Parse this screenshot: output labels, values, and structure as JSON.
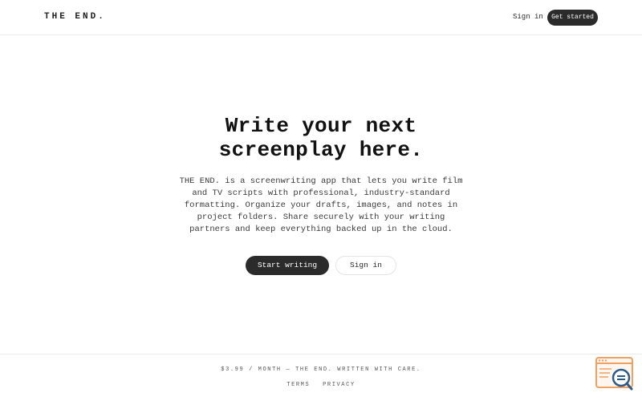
{
  "header": {
    "logo": "THE END.",
    "sign_in": "Sign in",
    "get_started": "Get started"
  },
  "hero": {
    "title_line1": "Write your next",
    "title_line2": "screenplay here.",
    "description": [
      "THE END. is a screenwriting app that lets you write film",
      "and TV scripts with professional, industry-standard",
      "formatting. Organize your drafts, images, and notes in",
      "project folders. Share securely with your writing",
      "partners and keep everything backed up in the cloud."
    ],
    "primary_button": "Start writing",
    "secondary_button": "Sign in"
  },
  "footer": {
    "note": "$3.99 / MONTH — THE END. WRITTEN WITH CARE.",
    "links": [
      "TERMS",
      "PRIVACY"
    ]
  },
  "widget": {
    "icon": "browser-search-icon",
    "accent_color": "#f0a060",
    "icon_color": "#2e5c8a"
  },
  "colors": {
    "primary_button_bg": "#2b2b2b",
    "text": "#111111",
    "background": "#ffffff"
  }
}
